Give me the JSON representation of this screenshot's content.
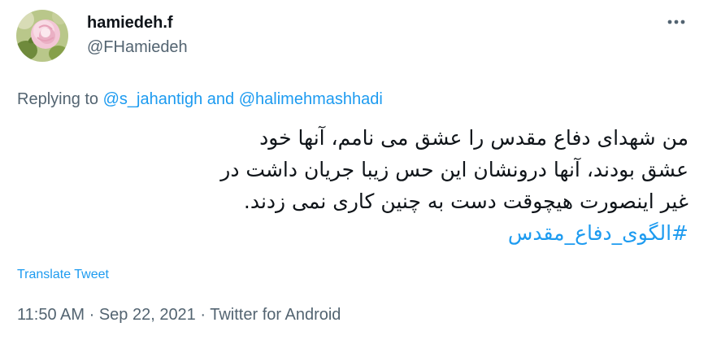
{
  "author": {
    "display_name": "hamiedeh.f",
    "handle": "@FHamiedeh",
    "avatar_icon": "rose-avatar-icon"
  },
  "more_icon": "more-horizontal-icon",
  "reply": {
    "prefix": "Replying to",
    "user1": "@s_jahantigh",
    "conjunction": "and",
    "user2": "@halimehmashhadi"
  },
  "tweet": {
    "lines": [
      "من شهدای دفاع مقدس را عشق می نامم، آنها خود",
      "عشق بودند، آنها درونشان این حس زیبا جریان داشت در",
      "غیر اینصورت هیچوقت دست به چنین کاری نمی زدند."
    ],
    "hashtag": "#الگوی_دفاع_مقدس"
  },
  "translate_label": "Translate Tweet",
  "meta": {
    "time": "11:50 AM",
    "separator": " · ",
    "date": "Sep 22, 2021",
    "source": "Twitter for Android"
  },
  "colors": {
    "link": "#1d9bf0",
    "secondary_text": "#536471",
    "primary_text": "#0f1419"
  }
}
